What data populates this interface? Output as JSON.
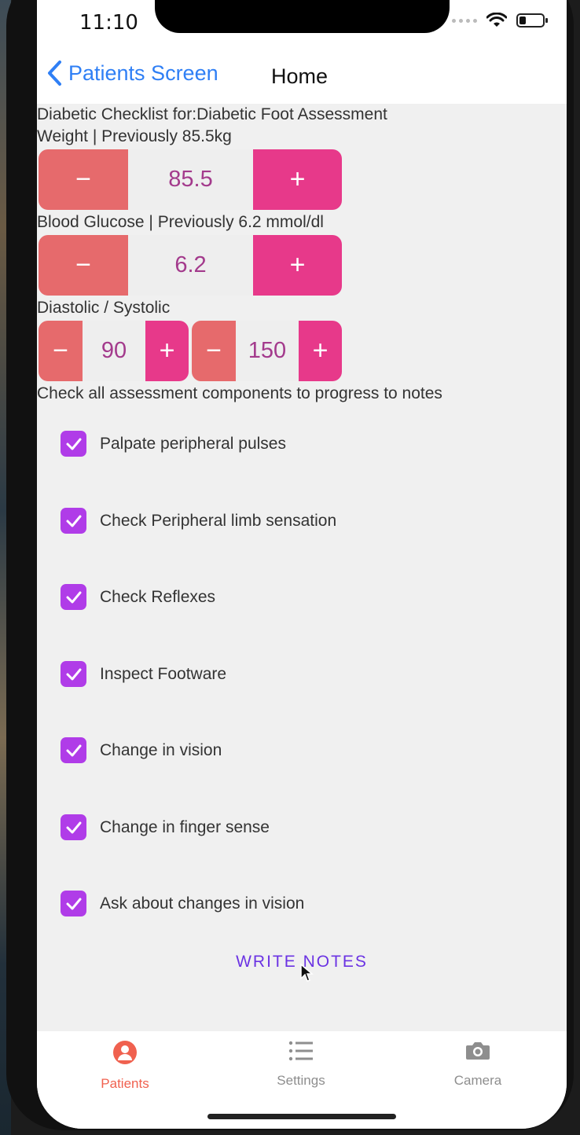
{
  "status_bar": {
    "time": "11:10"
  },
  "nav": {
    "back_label": "Patients Screen",
    "title": "Home"
  },
  "checklist_title": "Diabetic Checklist for:Diabetic Foot Assessment",
  "weight": {
    "label": "Weight | Previously 85.5kg",
    "value": "85.5",
    "minus": "−",
    "plus": "+"
  },
  "glucose": {
    "label": "Blood Glucose | Previously 6.2 mmol/dl",
    "value": "6.2",
    "minus": "−",
    "plus": "+"
  },
  "bp": {
    "label": "Diastolic / Systolic",
    "diastolic": {
      "value": "90",
      "minus": "−",
      "plus": "+"
    },
    "systolic": {
      "value": "150",
      "minus": "−",
      "plus": "+"
    }
  },
  "assessment_hint": "Check all assessment components to progress to notes",
  "checklist_items": [
    {
      "label": "Palpate peripheral pulses",
      "checked": true
    },
    {
      "label": "Check Peripheral limb sensation",
      "checked": true
    },
    {
      "label": "Check Reflexes",
      "checked": true
    },
    {
      "label": "Inspect Footware",
      "checked": true
    },
    {
      "label": "Change in vision",
      "checked": true
    },
    {
      "label": "Change in finger sense",
      "checked": true
    },
    {
      "label": "Ask about changes in vision",
      "checked": true
    }
  ],
  "write_notes_label": "WRITE NOTES",
  "tabs": [
    {
      "label": "Patients",
      "icon": "person-icon",
      "active": true
    },
    {
      "label": "Settings",
      "icon": "list-icon",
      "active": false
    },
    {
      "label": "Camera",
      "icon": "camera-icon",
      "active": false
    }
  ],
  "colors": {
    "accent": "#2f7ff5",
    "stepper_minus": "#e66a6c",
    "stepper_plus": "#e7398a",
    "stepper_value_text": "#a33a8c",
    "checkbox": "#b03ce8",
    "write_notes": "#6b33e3",
    "tab_active": "#f0614f",
    "tab_inactive": "#8e8e8e"
  }
}
